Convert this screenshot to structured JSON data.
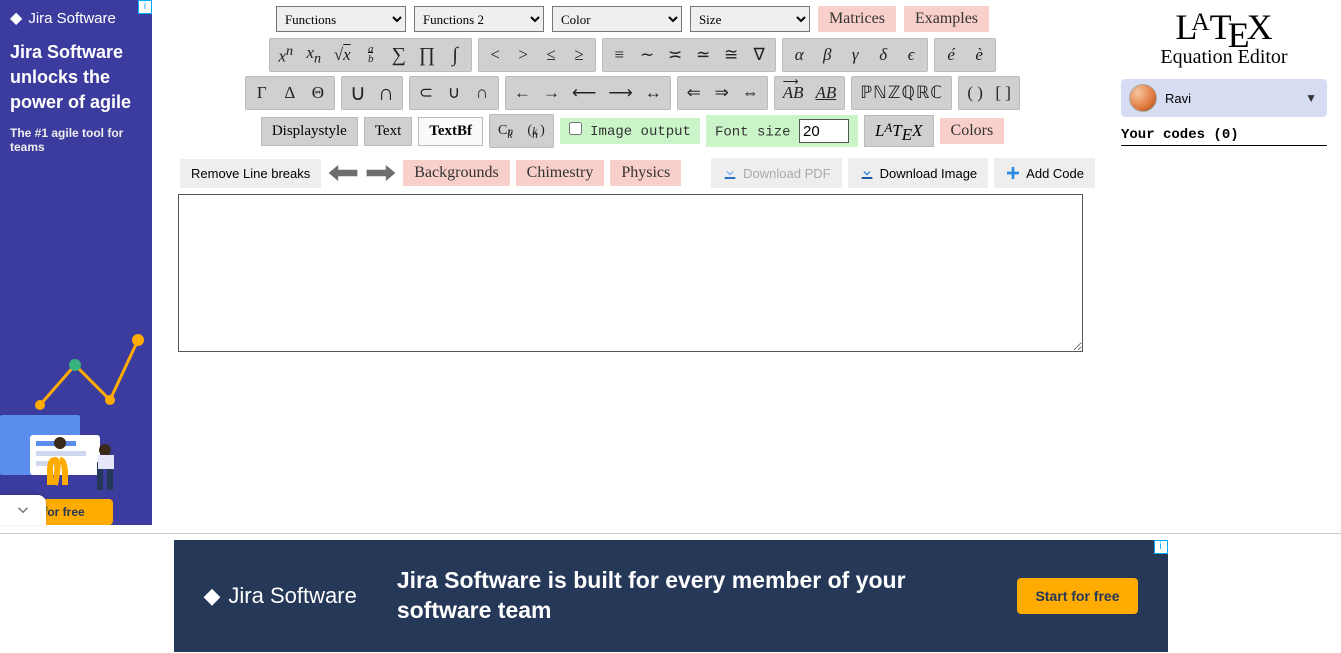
{
  "ads": {
    "left": {
      "brand": "Jira Software",
      "headline": "Jira Software unlocks the power of agile",
      "sub": "The #1 agile tool for teams",
      "cta": "rt for free",
      "info": "i"
    },
    "bottom": {
      "brand": "Jira Software",
      "headline": "Jira Software is built for every member of your software team",
      "cta": "Start for free",
      "info": "i"
    }
  },
  "top_selects": {
    "functions": "Functions",
    "functions2": "Functions 2",
    "color": "Color",
    "size": "Size"
  },
  "top_tags": {
    "matrices": "Matrices",
    "examples": "Examples"
  },
  "sym": {
    "row1": {
      "g1": [
        "xⁿ",
        "xₙ",
        "√x",
        "a⁄b",
        "∑",
        "∏",
        "∫"
      ],
      "g2": [
        "<",
        ">",
        "≤",
        "≥"
      ],
      "g3": [
        "≡",
        "∼",
        "≍",
        "≃",
        "≅",
        "∇"
      ],
      "g4": [
        "α",
        "β",
        "γ",
        "δ",
        "ϵ"
      ],
      "g5": [
        "é",
        "è"
      ]
    },
    "row2": {
      "g1": [
        "Γ",
        "Δ",
        "Θ"
      ],
      "g2": [
        "∪",
        "∩"
      ],
      "g3": [
        "⊂",
        "∪",
        "∩"
      ],
      "g4": [
        "←",
        "→",
        "⟵",
        "⟶",
        "↔"
      ],
      "g5": [
        "⇐",
        "⇒",
        "⇔"
      ],
      "g6": [
        "AB→",
        "A͟B͟"
      ],
      "g7": [
        "ℙℕℤℚℝℂ"
      ],
      "g8": [
        "( )",
        "[ ]"
      ]
    },
    "row3": {
      "displaystyle": "Displaystyle",
      "text": "Text",
      "textbf": "TextBf",
      "cnk": [
        "Cₙᵏ",
        "(ₖⁿ)"
      ],
      "imgout": "Image output",
      "fontsize_label": "Font size",
      "fontsize_value": "20",
      "colors": "Colors"
    }
  },
  "actions": {
    "remove_breaks": "Remove Line breaks",
    "backgrounds": "Backgrounds",
    "chemistry": "Chimestry",
    "physics": "Physics",
    "dl_pdf": "Download PDF",
    "dl_img": "Download Image",
    "add_code": "Add Code"
  },
  "editor_value": "",
  "right": {
    "sub": "Equation Editor",
    "user": "Ravi",
    "codes_head": "Your codes (0)"
  }
}
